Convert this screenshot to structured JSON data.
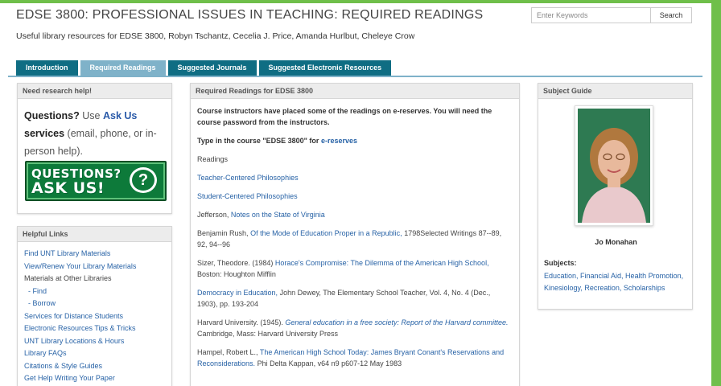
{
  "header": {
    "title": "EDSE 3800: PROFESSIONAL ISSUES IN TEACHING: REQUIRED READINGS",
    "subtitle": "Useful library resources for EDSE 3800, Robyn Tschantz, Cecelia J. Price, Amanda Hurlbut, Cheleye Crow"
  },
  "search": {
    "placeholder": "Enter Keywords",
    "button_label": "Search"
  },
  "tabs": [
    {
      "label": "Introduction"
    },
    {
      "label": "Required Readings"
    },
    {
      "label": "Suggested Journals"
    },
    {
      "label": "Suggested Electronic Resources"
    }
  ],
  "help": {
    "header": "Need research help!",
    "questions": "Questions?",
    "use": "Use",
    "ask_us_link": "Ask Us",
    "services": "services",
    "details": "(email, phone, or in-person help).",
    "banner_line1": "QUESTIONS?",
    "banner_line2": "ASK US!",
    "banner_glyph": "?"
  },
  "helpful_links": {
    "header": "Helpful Links",
    "items": [
      {
        "label": "Find UNT Library Materials"
      },
      {
        "label": "View/Renew Your Library Materials"
      },
      {
        "label": "Materials at Other Libraries"
      },
      {
        "label": "- Find"
      },
      {
        "label": "- Borrow"
      },
      {
        "label": "Services for Distance Students"
      },
      {
        "label": "Electronic Resources Tips & Tricks"
      },
      {
        "label": "UNT Library Locations & Hours"
      },
      {
        "label": "Library FAQs"
      },
      {
        "label": "Citations & Style Guides"
      },
      {
        "label": "Get Help Writing Your Paper"
      }
    ]
  },
  "readings": {
    "header": "Required Readings for EDSE 3800",
    "intro": "Course instructors have placed some of the readings on e-reserves. You will need the course password from the instructors.",
    "type_in_prefix": "Type in the course \"EDSE 3800\" for",
    "type_in_link": "e-reserves",
    "readings_label": "Readings",
    "link1": "Teacher-Centered Philosophies",
    "link2": "Student-Centered Philosophies",
    "jefferson_prefix": "Jefferson,",
    "jefferson_link": "Notes on the State of Virginia",
    "rush_prefix": "Benjamin Rush,",
    "rush_link": "Of the Mode of Education Proper in a Republic,",
    "rush_suffix": "1798Selected Writings 87--89, 92, 94--96",
    "sizer_prefix": "Sizer, Theodore. (1984)",
    "sizer_link": "Horace's Compromise: The Dilemma of the American High School,",
    "sizer_suffix": "Boston: Houghton Mifflin",
    "dewey_link": "Democracy in Education,",
    "dewey_suffix": "John Dewey, The Elementary School Teacher, Vol. 4, No. 4 (Dec., 1903), pp. 193-204",
    "harvard_prefix": "Harvard University. (1945).",
    "harvard_link": "General education in a free society: Report of the Harvard committee.",
    "harvard_suffix": "Cambridge, Mass: Harvard University Press",
    "hampel_prefix": "Hampel, Robert L.,",
    "hampel_link": "The American High School Today: James Bryant Conant's Reservations and Reconsiderations.",
    "hampel_suffix": "Phi Delta Kappan, v64 n9 p607-12 May 1983"
  },
  "subject_guide": {
    "header": "Subject Guide",
    "name": "Jo Monahan",
    "subjects_label": "Subjects:",
    "subjects": "Education, Financial Aid, Health Promotion, Kinesiology, Recreation, Scholarships"
  },
  "colors": {
    "tab": "#0f6d83",
    "tab_active": "#7fb2c9",
    "link": "#2762a6",
    "frame_green": "#6fbf4a"
  }
}
